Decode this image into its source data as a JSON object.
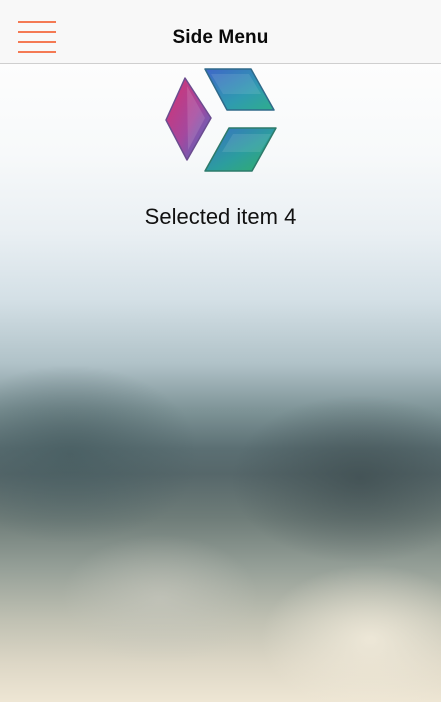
{
  "header": {
    "title": "Side Menu",
    "menu_icon": "hamburger-menu-icon",
    "menu_icon_color": "#f47a54",
    "background": "#f8f8f8"
  },
  "main": {
    "logo_icon": "cube-logo-icon",
    "selected_text": "Selected item 4"
  }
}
